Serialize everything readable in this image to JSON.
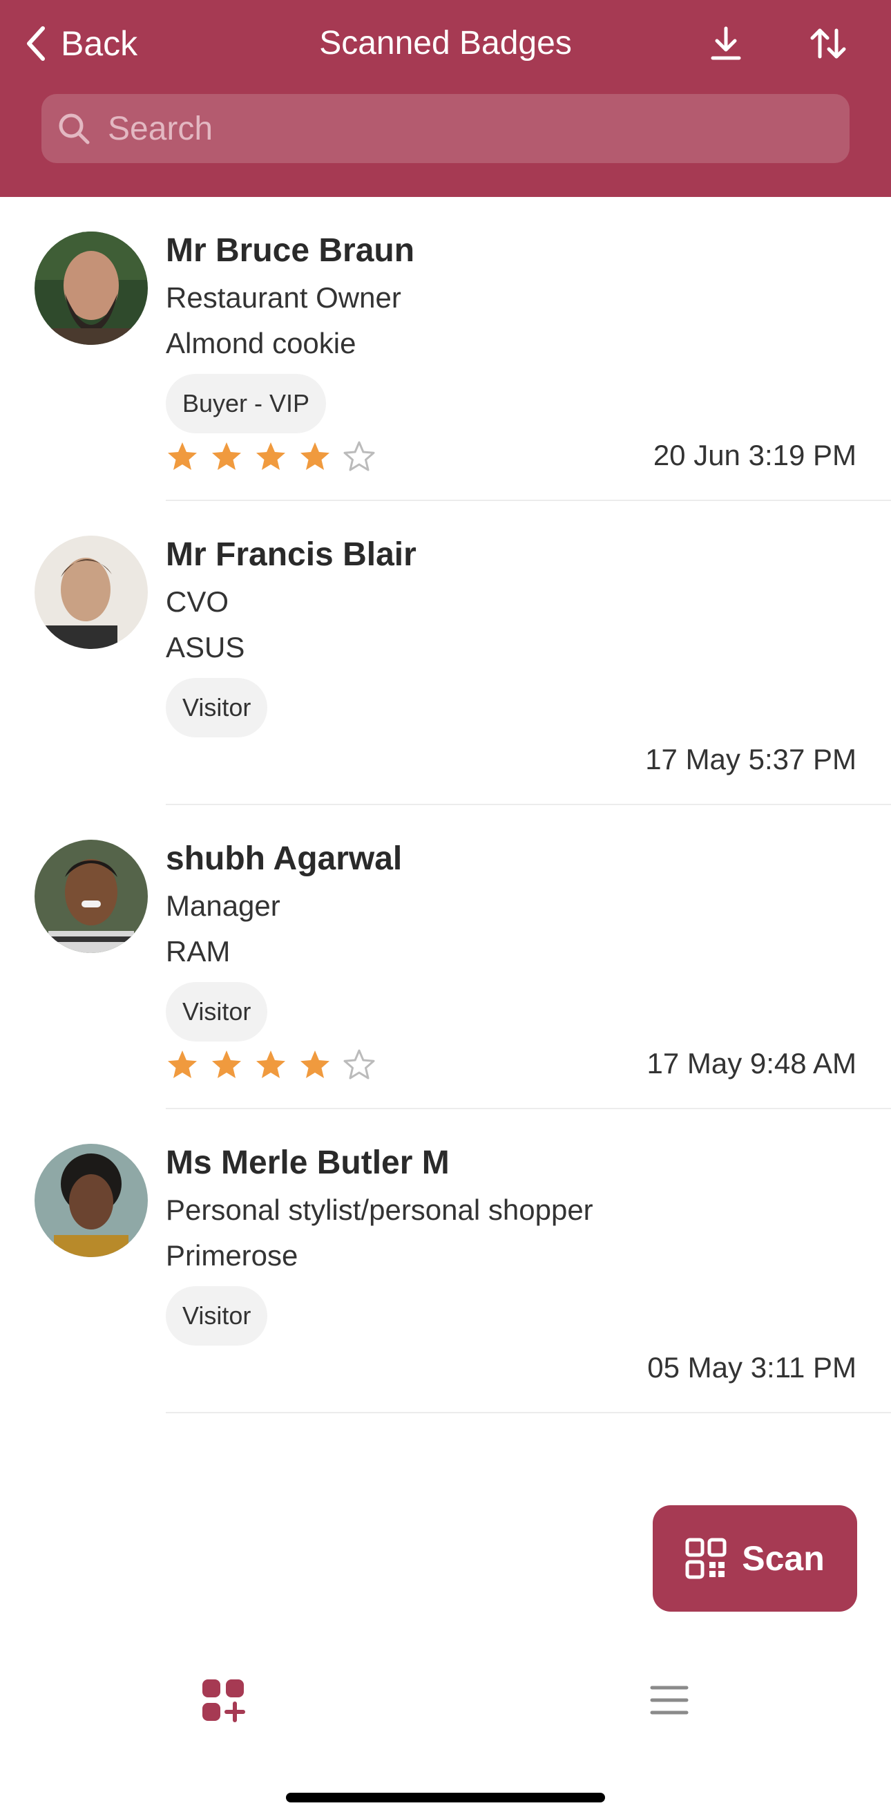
{
  "header": {
    "back_label": "Back",
    "title": "Scanned Badges",
    "download_icon": "download-icon",
    "sort_icon": "sort-arrows-icon",
    "background_color": "#a63a53"
  },
  "search": {
    "placeholder": "Search",
    "value": ""
  },
  "badges": [
    {
      "name": "Mr Bruce Braun",
      "role": "Restaurant Owner",
      "company": "Almond cookie",
      "tag": "Buyer - VIP",
      "rating": 4,
      "max_rating": 5,
      "time": "20 Jun 3:19 PM"
    },
    {
      "name": "Mr Francis Blair",
      "role": "CVO",
      "company": "ASUS",
      "tag": "Visitor",
      "rating": null,
      "max_rating": 5,
      "time": "17 May 5:37 PM"
    },
    {
      "name": "shubh Agarwal",
      "role": "Manager",
      "company": "RAM",
      "tag": "Visitor",
      "rating": 4,
      "max_rating": 5,
      "time": "17 May 9:48 AM"
    },
    {
      "name": "Ms Merle Butler M",
      "role": "Personal stylist/personal shopper",
      "company": "Primerose",
      "tag": "Visitor",
      "rating": null,
      "max_rating": 5,
      "time": "05 May 3:11 PM"
    }
  ],
  "scan_button": {
    "label": "Scan",
    "icon": "qr-code-icon"
  },
  "tabbar": {
    "left_icon": "grid-plus-icon",
    "right_icon": "menu-icon",
    "active_color": "#a63a53",
    "inactive_color": "#8a8a8a"
  },
  "colors": {
    "star_filled": "#f09a3e",
    "star_empty": "#bbbbbb",
    "accent": "#a63a53"
  }
}
